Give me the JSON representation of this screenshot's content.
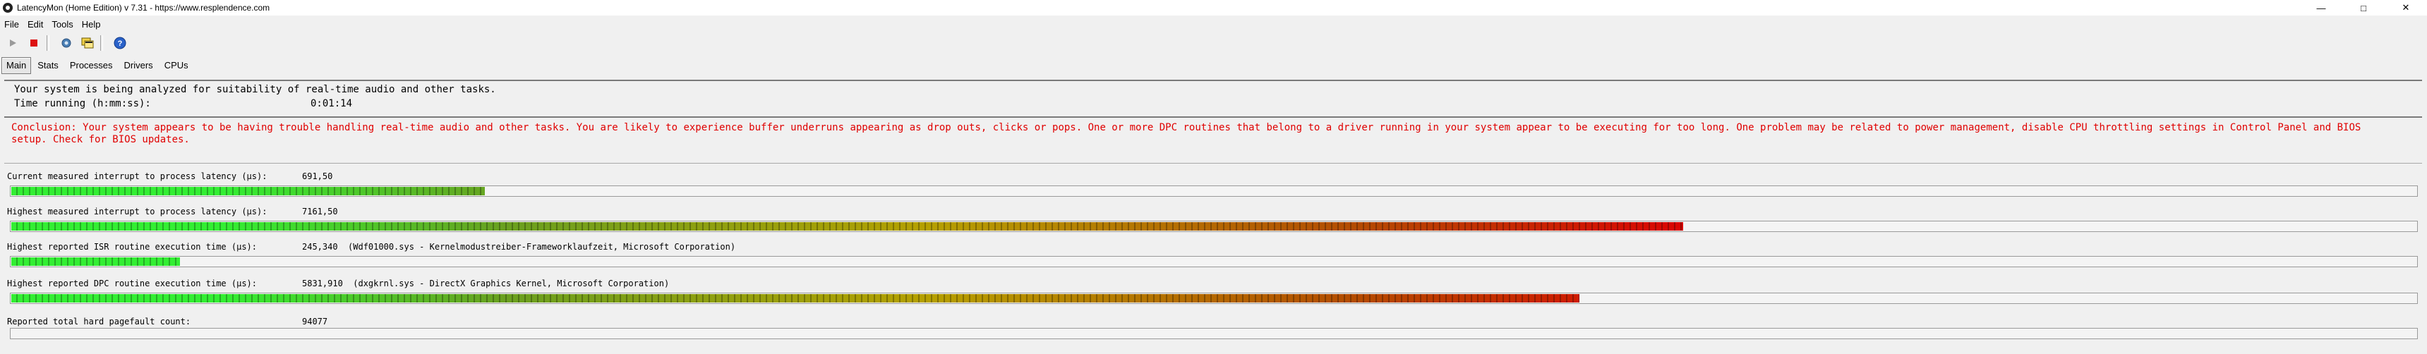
{
  "window": {
    "title": "LatencyMon  (Home Edition)  v 7.31 - https://www.resplendence.com",
    "controls": [
      "minimize-icon",
      "maximize-icon",
      "close-icon"
    ]
  },
  "menu": {
    "items": [
      "File",
      "Edit",
      "Tools",
      "Help"
    ]
  },
  "toolbar": {
    "buttons": [
      "play-icon",
      "stop-icon",
      "gear-icon",
      "windows-icon",
      "help-icon"
    ]
  },
  "tabs": {
    "items": [
      "Main",
      "Stats",
      "Processes",
      "Drivers",
      "CPUs"
    ],
    "active": "Main"
  },
  "status": {
    "line1": "Your system is being analyzed for suitability of real-time audio and other tasks.",
    "time_label": "Time running (h:mm:ss):",
    "time_value": "0:01:14"
  },
  "conclusion": {
    "text": "Conclusion: Your system appears to be having trouble handling real-time audio and other tasks. You are likely to experience buffer underruns appearing as drop outs, clicks or pops. One or more DPC routines that belong to a driver running in your system appear to be executing for too long. One problem may be related to power management, disable CPU throttling settings in Control Panel and BIOS setup. Check for BIOS updates.",
    "color": "#e00000"
  },
  "metrics": [
    {
      "label": "Current measured interrupt to process latency (µs):",
      "value": "691,50",
      "level": 0.197
    },
    {
      "label": "Highest measured interrupt to process latency (µs):",
      "value": "7161,50",
      "level": 0.695
    },
    {
      "label": "Highest reported ISR routine execution time (µs):",
      "value": "245,340  (Wdf01000.sys - Kernelmodustreiber-Frameworklaufzeit, Microsoft Corporation)",
      "level": 0.07
    },
    {
      "label": "Highest reported DPC routine execution time (µs):",
      "value": "5831,910  (dxgkrnl.sys - DirectX Graphics Kernel, Microsoft Corporation)",
      "level": 0.652
    },
    {
      "label": "Reported total hard pagefault count:",
      "value": "94077",
      "level": 0
    }
  ],
  "colors": {
    "bar_green": "#33ee33",
    "bar_yellow": "#b6a000",
    "bar_red": "#dd0000"
  }
}
